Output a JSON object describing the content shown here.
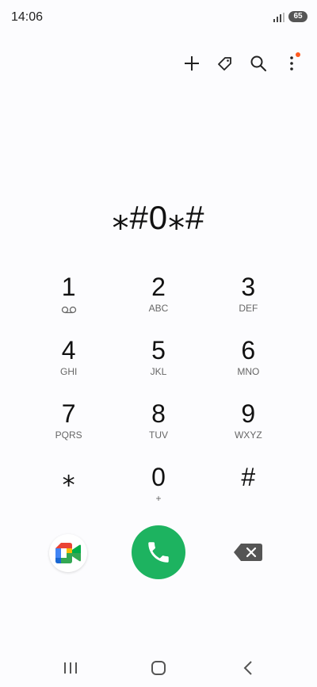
{
  "status_bar": {
    "time": "14:06",
    "battery": "65"
  },
  "toolbar": {
    "icons": [
      "plus-icon",
      "tag-icon",
      "search-icon",
      "more-vert-icon"
    ],
    "accent_dot_color": "#ff5a1f"
  },
  "dial_display": {
    "number": "⁎#0⁎#"
  },
  "keypad": {
    "keys": [
      {
        "digit": "1",
        "letters": ""
      },
      {
        "digit": "2",
        "letters": "ABC"
      },
      {
        "digit": "3",
        "letters": "DEF"
      },
      {
        "digit": "4",
        "letters": "GHI"
      },
      {
        "digit": "5",
        "letters": "JKL"
      },
      {
        "digit": "6",
        "letters": "MNO"
      },
      {
        "digit": "7",
        "letters": "PQRS"
      },
      {
        "digit": "8",
        "letters": "TUV"
      },
      {
        "digit": "9",
        "letters": "WXYZ"
      },
      {
        "digit": "⁎",
        "letters": ""
      },
      {
        "digit": "0",
        "letters": "+"
      },
      {
        "digit": "#",
        "letters": ""
      }
    ]
  },
  "bottom_actions": {
    "call_color": "#1db360",
    "icons": [
      "google-meet-icon",
      "phone-icon",
      "backspace-icon"
    ]
  },
  "nav_bar": {
    "icons": [
      "recents-icon",
      "home-icon",
      "back-icon"
    ]
  }
}
